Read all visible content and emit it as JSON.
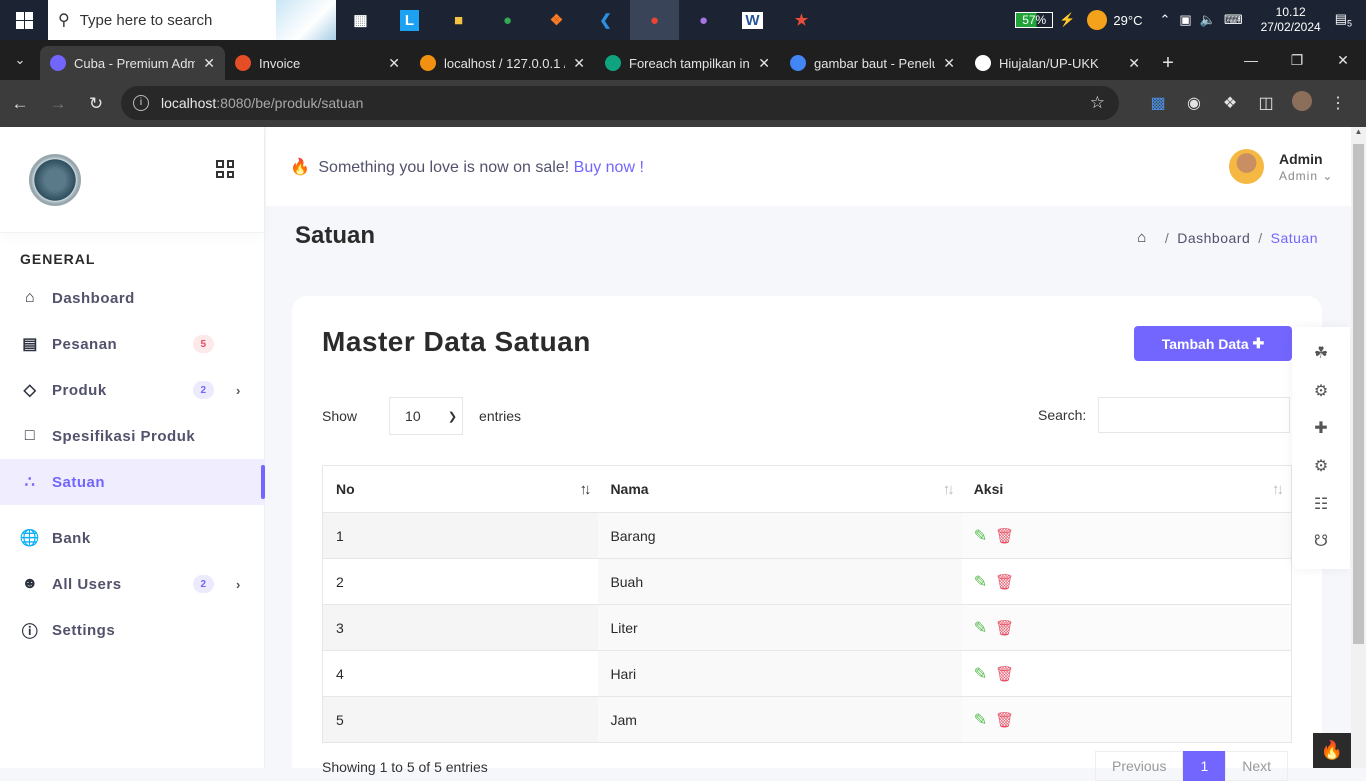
{
  "taskbar": {
    "search_placeholder": "Type here to search",
    "battery": "57%",
    "temperature": "29°C",
    "time": "10.12",
    "date": "27/02/2024",
    "notif_count": "5"
  },
  "browser": {
    "tabs": [
      {
        "title": "Cuba - Premium Adm",
        "color": "#7366ff",
        "active": true
      },
      {
        "title": "Invoice",
        "color": "#e44d26"
      },
      {
        "title": "localhost / 127.0.0.1 /",
        "color": "#f29111"
      },
      {
        "title": "Foreach tampilkan in",
        "color": "#10a37f"
      },
      {
        "title": "gambar baut - Penelu",
        "color": "#4285f4"
      },
      {
        "title": "Hiujalan/UP-UKK",
        "color": "#ffffff"
      }
    ],
    "url_host": "localhost",
    "url_path": ":8080/be/produk/satuan"
  },
  "header": {
    "promo_text": "Something you love is now on sale!",
    "promo_link": "Buy now !",
    "user_name": "Admin",
    "user_role": "Admin"
  },
  "sidebar": {
    "section": "GENERAL",
    "items": [
      {
        "label": "Dashboard",
        "icon": "home-icon"
      },
      {
        "label": "Pesanan",
        "badge": "5",
        "icon": "basket-icon"
      },
      {
        "label": "Produk",
        "badge": "2",
        "icon": "layers-icon"
      },
      {
        "label": "Spesifikasi Produk",
        "icon": "clipboard-icon"
      },
      {
        "label": "Satuan",
        "icon": "nodes-icon"
      },
      {
        "label": "Bank",
        "icon": "globe-icon"
      },
      {
        "label": "All Users",
        "badge": "2",
        "icon": "users-icon"
      },
      {
        "label": "Settings",
        "icon": "info-icon"
      }
    ]
  },
  "page": {
    "title": "Satuan",
    "breadcrumb": [
      "Dashboard",
      "Satuan"
    ],
    "card_title": "Master Data Satuan",
    "add_button": "Tambah Data",
    "show_label": "Show",
    "entries_label": "entries",
    "page_size": "10",
    "search_label": "Search:",
    "columns": [
      "No",
      "Nama",
      "Aksi"
    ],
    "rows": [
      {
        "no": "1",
        "nama": "Barang"
      },
      {
        "no": "2",
        "nama": "Buah"
      },
      {
        "no": "3",
        "nama": "Liter"
      },
      {
        "no": "4",
        "nama": "Hari"
      },
      {
        "no": "5",
        "nama": "Jam"
      }
    ],
    "info": "Showing 1 to 5 of 5 entries",
    "pager": [
      "Previous",
      "1",
      "Next"
    ]
  },
  "colors": {
    "accent": "#7366ff",
    "edit": "#54ba4a",
    "delete": "#e64f63"
  }
}
